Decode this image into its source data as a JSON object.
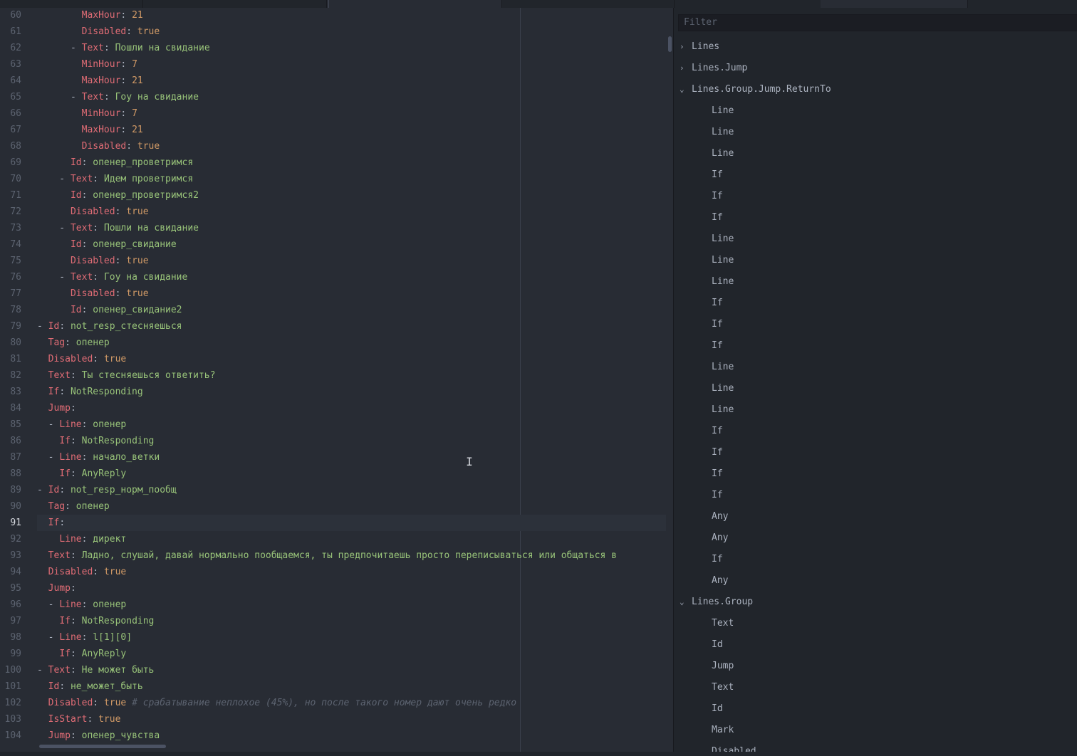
{
  "editor": {
    "lines": [
      {
        "n": "60",
        "parts": [
          [
            "p",
            "        "
          ],
          [
            "k",
            "MaxHour"
          ],
          [
            "p",
            ": "
          ],
          [
            "n",
            "21"
          ]
        ]
      },
      {
        "n": "61",
        "parts": [
          [
            "p",
            "        "
          ],
          [
            "k",
            "Disabled"
          ],
          [
            "p",
            ": "
          ],
          [
            "n",
            "true"
          ]
        ]
      },
      {
        "n": "62",
        "parts": [
          [
            "p",
            "      - "
          ],
          [
            "k",
            "Text"
          ],
          [
            "p",
            ": "
          ],
          [
            "v",
            "Пошли на свидание"
          ]
        ]
      },
      {
        "n": "63",
        "parts": [
          [
            "p",
            "        "
          ],
          [
            "k",
            "MinHour"
          ],
          [
            "p",
            ": "
          ],
          [
            "n",
            "7"
          ]
        ]
      },
      {
        "n": "64",
        "parts": [
          [
            "p",
            "        "
          ],
          [
            "k",
            "MaxHour"
          ],
          [
            "p",
            ": "
          ],
          [
            "n",
            "21"
          ]
        ]
      },
      {
        "n": "65",
        "parts": [
          [
            "p",
            "      - "
          ],
          [
            "k",
            "Text"
          ],
          [
            "p",
            ": "
          ],
          [
            "v",
            "Гоу на свидание"
          ]
        ]
      },
      {
        "n": "66",
        "parts": [
          [
            "p",
            "        "
          ],
          [
            "k",
            "MinHour"
          ],
          [
            "p",
            ": "
          ],
          [
            "n",
            "7"
          ]
        ]
      },
      {
        "n": "67",
        "parts": [
          [
            "p",
            "        "
          ],
          [
            "k",
            "MaxHour"
          ],
          [
            "p",
            ": "
          ],
          [
            "n",
            "21"
          ]
        ]
      },
      {
        "n": "68",
        "parts": [
          [
            "p",
            "        "
          ],
          [
            "k",
            "Disabled"
          ],
          [
            "p",
            ": "
          ],
          [
            "n",
            "true"
          ]
        ]
      },
      {
        "n": "69",
        "parts": [
          [
            "p",
            "      "
          ],
          [
            "k",
            "Id"
          ],
          [
            "p",
            ": "
          ],
          [
            "v",
            "опенер_проветримся"
          ]
        ]
      },
      {
        "n": "70",
        "parts": [
          [
            "p",
            "    - "
          ],
          [
            "k",
            "Text"
          ],
          [
            "p",
            ": "
          ],
          [
            "v",
            "Идем проветримся"
          ]
        ]
      },
      {
        "n": "71",
        "parts": [
          [
            "p",
            "      "
          ],
          [
            "k",
            "Id"
          ],
          [
            "p",
            ": "
          ],
          [
            "v",
            "опенер_проветримся2"
          ]
        ]
      },
      {
        "n": "72",
        "parts": [
          [
            "p",
            "      "
          ],
          [
            "k",
            "Disabled"
          ],
          [
            "p",
            ": "
          ],
          [
            "n",
            "true"
          ]
        ]
      },
      {
        "n": "73",
        "parts": [
          [
            "p",
            "    - "
          ],
          [
            "k",
            "Text"
          ],
          [
            "p",
            ": "
          ],
          [
            "v",
            "Пошли на свидание"
          ]
        ]
      },
      {
        "n": "74",
        "parts": [
          [
            "p",
            "      "
          ],
          [
            "k",
            "Id"
          ],
          [
            "p",
            ": "
          ],
          [
            "v",
            "опенер_свидание"
          ]
        ]
      },
      {
        "n": "75",
        "parts": [
          [
            "p",
            "      "
          ],
          [
            "k",
            "Disabled"
          ],
          [
            "p",
            ": "
          ],
          [
            "n",
            "true"
          ]
        ]
      },
      {
        "n": "76",
        "parts": [
          [
            "p",
            "    - "
          ],
          [
            "k",
            "Text"
          ],
          [
            "p",
            ": "
          ],
          [
            "v",
            "Гоу на свидание"
          ]
        ]
      },
      {
        "n": "77",
        "parts": [
          [
            "p",
            "      "
          ],
          [
            "k",
            "Disabled"
          ],
          [
            "p",
            ": "
          ],
          [
            "n",
            "true"
          ]
        ]
      },
      {
        "n": "78",
        "parts": [
          [
            "p",
            "      "
          ],
          [
            "k",
            "Id"
          ],
          [
            "p",
            ": "
          ],
          [
            "v",
            "опенер_свидание2"
          ]
        ]
      },
      {
        "n": "79",
        "parts": [
          [
            "p",
            "- "
          ],
          [
            "k",
            "Id"
          ],
          [
            "p",
            ": "
          ],
          [
            "v",
            "not_resp_стесняешься"
          ]
        ]
      },
      {
        "n": "80",
        "parts": [
          [
            "p",
            "  "
          ],
          [
            "k",
            "Tag"
          ],
          [
            "p",
            ": "
          ],
          [
            "v",
            "опенер"
          ]
        ]
      },
      {
        "n": "81",
        "parts": [
          [
            "p",
            "  "
          ],
          [
            "k",
            "Disabled"
          ],
          [
            "p",
            ": "
          ],
          [
            "n",
            "true"
          ]
        ]
      },
      {
        "n": "82",
        "parts": [
          [
            "p",
            "  "
          ],
          [
            "k",
            "Text"
          ],
          [
            "p",
            ": "
          ],
          [
            "v",
            "Ты стесняешься ответить?"
          ]
        ]
      },
      {
        "n": "83",
        "parts": [
          [
            "p",
            "  "
          ],
          [
            "k",
            "If"
          ],
          [
            "p",
            ": "
          ],
          [
            "v",
            "NotResponding"
          ]
        ]
      },
      {
        "n": "84",
        "parts": [
          [
            "p",
            "  "
          ],
          [
            "k",
            "Jump"
          ],
          [
            "p",
            ":"
          ]
        ]
      },
      {
        "n": "85",
        "parts": [
          [
            "p",
            "  - "
          ],
          [
            "k",
            "Line"
          ],
          [
            "p",
            ": "
          ],
          [
            "v",
            "опенер"
          ]
        ]
      },
      {
        "n": "86",
        "parts": [
          [
            "p",
            "    "
          ],
          [
            "k",
            "If"
          ],
          [
            "p",
            ": "
          ],
          [
            "v",
            "NotResponding"
          ]
        ]
      },
      {
        "n": "87",
        "parts": [
          [
            "p",
            "  - "
          ],
          [
            "k",
            "Line"
          ],
          [
            "p",
            ": "
          ],
          [
            "v",
            "начало_ветки"
          ]
        ]
      },
      {
        "n": "88",
        "parts": [
          [
            "p",
            "    "
          ],
          [
            "k",
            "If"
          ],
          [
            "p",
            ": "
          ],
          [
            "v",
            "AnyReply"
          ]
        ]
      },
      {
        "n": "89",
        "parts": [
          [
            "p",
            "- "
          ],
          [
            "k",
            "Id"
          ],
          [
            "p",
            ": "
          ],
          [
            "v",
            "not_resp_норм_пообщ"
          ]
        ]
      },
      {
        "n": "90",
        "parts": [
          [
            "p",
            "  "
          ],
          [
            "k",
            "Tag"
          ],
          [
            "p",
            ": "
          ],
          [
            "v",
            "опенер"
          ]
        ]
      },
      {
        "n": "91",
        "cur": true,
        "parts": [
          [
            "p",
            "  "
          ],
          [
            "k",
            "If"
          ],
          [
            "p",
            ":"
          ]
        ]
      },
      {
        "n": "92",
        "parts": [
          [
            "p",
            "    "
          ],
          [
            "k",
            "Line"
          ],
          [
            "p",
            ": "
          ],
          [
            "v",
            "директ"
          ]
        ]
      },
      {
        "n": "93",
        "parts": [
          [
            "p",
            "  "
          ],
          [
            "k",
            "Text"
          ],
          [
            "p",
            ": "
          ],
          [
            "v",
            "Ладно, слушай, давай нормально пообщаемся, ты предпочитаешь просто переписываться или общаться в"
          ]
        ]
      },
      {
        "n": "94",
        "parts": [
          [
            "p",
            "  "
          ],
          [
            "k",
            "Disabled"
          ],
          [
            "p",
            ": "
          ],
          [
            "n",
            "true"
          ]
        ]
      },
      {
        "n": "95",
        "parts": [
          [
            "p",
            "  "
          ],
          [
            "k",
            "Jump"
          ],
          [
            "p",
            ":"
          ]
        ]
      },
      {
        "n": "96",
        "parts": [
          [
            "p",
            "  - "
          ],
          [
            "k",
            "Line"
          ],
          [
            "p",
            ": "
          ],
          [
            "v",
            "опенер"
          ]
        ]
      },
      {
        "n": "97",
        "parts": [
          [
            "p",
            "    "
          ],
          [
            "k",
            "If"
          ],
          [
            "p",
            ": "
          ],
          [
            "v",
            "NotResponding"
          ]
        ]
      },
      {
        "n": "98",
        "parts": [
          [
            "p",
            "  - "
          ],
          [
            "k",
            "Line"
          ],
          [
            "p",
            ": "
          ],
          [
            "v",
            "l[1][0]"
          ]
        ]
      },
      {
        "n": "99",
        "parts": [
          [
            "p",
            "    "
          ],
          [
            "k",
            "If"
          ],
          [
            "p",
            ": "
          ],
          [
            "v",
            "AnyReply"
          ]
        ]
      },
      {
        "n": "100",
        "parts": [
          [
            "p",
            "- "
          ],
          [
            "k",
            "Text"
          ],
          [
            "p",
            ": "
          ],
          [
            "v",
            "Не может быть"
          ]
        ]
      },
      {
        "n": "101",
        "parts": [
          [
            "p",
            "  "
          ],
          [
            "k",
            "Id"
          ],
          [
            "p",
            ": "
          ],
          [
            "v",
            "не_может_быть"
          ]
        ]
      },
      {
        "n": "102",
        "parts": [
          [
            "p",
            "  "
          ],
          [
            "k",
            "Disabled"
          ],
          [
            "p",
            ": "
          ],
          [
            "n",
            "true"
          ],
          [
            "p",
            " "
          ],
          [
            "c",
            "# срабатывание неплохое (45%), но после такого номер дают очень редко"
          ]
        ]
      },
      {
        "n": "103",
        "parts": [
          [
            "p",
            "  "
          ],
          [
            "k",
            "IsStart"
          ],
          [
            "p",
            ": "
          ],
          [
            "n",
            "true"
          ]
        ]
      },
      {
        "n": "104",
        "parts": [
          [
            "p",
            "  "
          ],
          [
            "k",
            "Jump"
          ],
          [
            "p",
            ": "
          ],
          [
            "v",
            "опенер_чувства"
          ]
        ]
      }
    ]
  },
  "sidepane": {
    "filter_placeholder": "Filter",
    "tree": [
      {
        "level": 0,
        "chev": "›",
        "label": "Lines"
      },
      {
        "level": 0,
        "chev": "›",
        "label": "Lines.Jump"
      },
      {
        "level": 0,
        "chev": "⌄",
        "label": "Lines.Group.Jump.ReturnTo"
      },
      {
        "level": 1,
        "label": "Line"
      },
      {
        "level": 1,
        "label": "Line"
      },
      {
        "level": 1,
        "label": "Line"
      },
      {
        "level": 1,
        "label": "If"
      },
      {
        "level": 1,
        "label": "If"
      },
      {
        "level": 1,
        "label": "If"
      },
      {
        "level": 1,
        "label": "Line"
      },
      {
        "level": 1,
        "label": "Line"
      },
      {
        "level": 1,
        "label": "Line"
      },
      {
        "level": 1,
        "label": "If"
      },
      {
        "level": 1,
        "label": "If"
      },
      {
        "level": 1,
        "label": "If"
      },
      {
        "level": 1,
        "label": "Line"
      },
      {
        "level": 1,
        "label": "Line"
      },
      {
        "level": 1,
        "label": "Line"
      },
      {
        "level": 1,
        "label": "If"
      },
      {
        "level": 1,
        "label": "If"
      },
      {
        "level": 1,
        "label": "If"
      },
      {
        "level": 1,
        "label": "If"
      },
      {
        "level": 1,
        "label": "Any"
      },
      {
        "level": 1,
        "label": "Any"
      },
      {
        "level": 1,
        "label": "If"
      },
      {
        "level": 1,
        "label": "Any"
      },
      {
        "level": 0,
        "chev": "⌄",
        "label": "Lines.Group"
      },
      {
        "level": 1,
        "label": "Text"
      },
      {
        "level": 1,
        "label": "Id"
      },
      {
        "level": 1,
        "label": "Jump"
      },
      {
        "level": 1,
        "label": "Text"
      },
      {
        "level": 1,
        "label": "Id"
      },
      {
        "level": 1,
        "label": "Mark"
      },
      {
        "level": 1,
        "label": "Disabled"
      }
    ]
  },
  "colors": {
    "key": "#e06c75",
    "string": "#98c379",
    "number": "#d19a66",
    "comment": "#5c6370",
    "background": "#282c34",
    "panel": "#21252b"
  }
}
